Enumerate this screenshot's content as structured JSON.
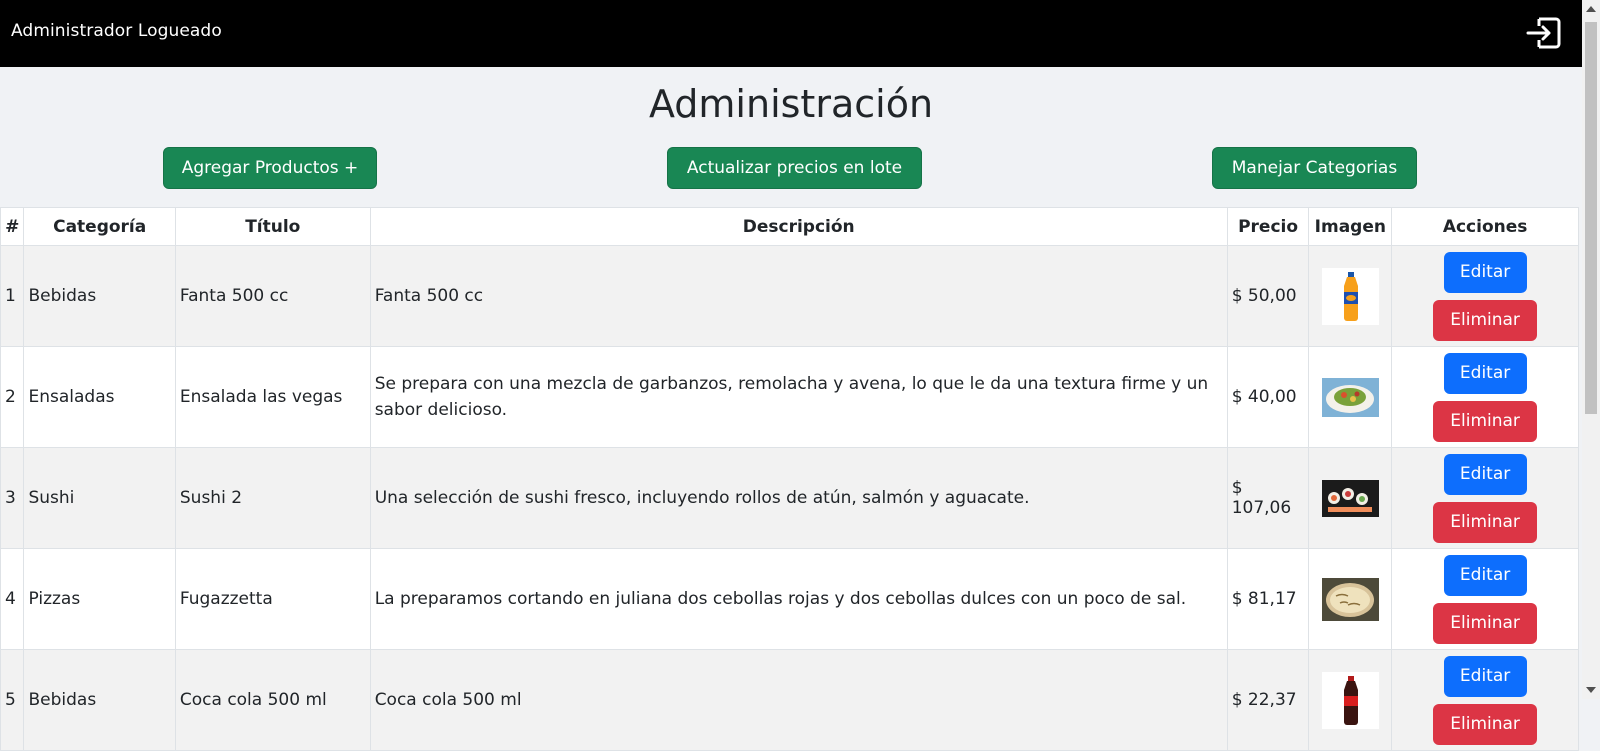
{
  "header": {
    "user_label": "Administrador Logueado",
    "logout_icon": "logout-icon"
  },
  "page": {
    "title": "Administración"
  },
  "toolbar": {
    "add_label": "Agregar Productos +",
    "prices_label": "Actualizar precios en lote",
    "categories_label": "Manejar Categorias"
  },
  "table": {
    "headers": [
      "#",
      "Categoría",
      "Título",
      "Descripción",
      "Precio",
      "Imagen",
      "Acciones"
    ],
    "edit_label": "Editar",
    "delete_label": "Eliminar",
    "rows": [
      {
        "num": "1",
        "category": "Bebidas",
        "title": "Fanta 500 cc",
        "description": "Fanta 500 cc",
        "price": "$ 50,00",
        "image": "fanta-bottle"
      },
      {
        "num": "2",
        "category": "Ensaladas",
        "title": "Ensalada las vegas",
        "description": "Se prepara con una mezcla de garbanzos, remolacha y avena, lo que le da una textura firme y un sabor delicioso.",
        "price": "$ 40,00",
        "image": "salad-plate"
      },
      {
        "num": "3",
        "category": "Sushi",
        "title": "Sushi 2",
        "description": "Una selección de sushi fresco, incluyendo rollos de atún, salmón y aguacate.",
        "price": "$ 107,06",
        "image": "sushi-platter"
      },
      {
        "num": "4",
        "category": "Pizzas",
        "title": "Fugazzetta",
        "description": "La preparamos cortando en juliana dos cebollas rojas y dos cebollas dulces con un poco de sal.",
        "price": "$ 81,17",
        "image": "pizza"
      },
      {
        "num": "5",
        "category": "Bebidas",
        "title": "Coca cola 500 ml",
        "description": "Coca cola 500 ml",
        "price": "$ 22,37",
        "image": "coca-cola-bottle"
      }
    ]
  },
  "colors": {
    "topbar": "#000000",
    "success": "#198754",
    "primary": "#0d6efd",
    "danger": "#dc3545"
  }
}
